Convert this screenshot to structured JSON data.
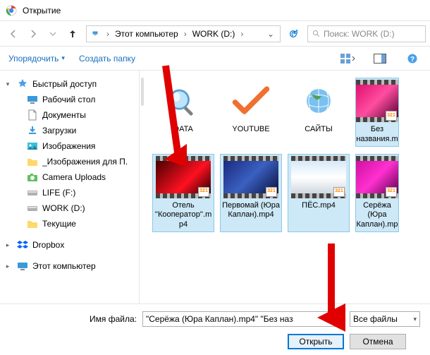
{
  "window": {
    "title": "Открытие"
  },
  "nav": {
    "breadcrumb": [
      "Этот компьютер",
      "WORK (D:)"
    ],
    "search_placeholder": "Поиск: WORK (D:)"
  },
  "toolbar": {
    "organize": "Упорядочить",
    "newfolder": "Создать папку"
  },
  "sidebar": {
    "quick": {
      "header": "Быстрый доступ",
      "items": [
        {
          "key": "desktop",
          "label": "Рабочий стол"
        },
        {
          "key": "documents",
          "label": "Документы"
        },
        {
          "key": "downloads",
          "label": "Загрузки"
        },
        {
          "key": "pictures",
          "label": "Изображения"
        },
        {
          "key": "picfolder",
          "label": "_Изображения для П."
        },
        {
          "key": "camera",
          "label": "Camera Uploads"
        },
        {
          "key": "life",
          "label": "LIFE (F:)"
        },
        {
          "key": "work",
          "label": "WORK (D:)"
        },
        {
          "key": "current",
          "label": "Текущие"
        }
      ]
    },
    "dropbox": "Dropbox",
    "thispc": "Этот компьютер"
  },
  "files": {
    "folders": [
      {
        "key": "data",
        "label": "DATA",
        "icon": "magnifier"
      },
      {
        "key": "youtube",
        "label": "YOUTUBE",
        "icon": "check"
      },
      {
        "key": "sites",
        "label": "САЙТЫ",
        "icon": "globe"
      }
    ],
    "videos": [
      {
        "key": "untitled",
        "label": "Без названия.m",
        "cls": "pink",
        "selected": true,
        "cut": true
      },
      {
        "key": "hotel",
        "label": "Отель ''Кооператор''.mp4",
        "cls": "red",
        "selected": true
      },
      {
        "key": "pervomay",
        "label": "Первомай (Юра Каплан).mp4",
        "cls": "blue",
        "selected": true
      },
      {
        "key": "pes",
        "label": "ПЁС.mp4",
        "cls": "white",
        "selected": true
      },
      {
        "key": "sereja",
        "label": "Серёжа (Юра Каплан).mp",
        "cls": "pink2",
        "selected": true,
        "cut": true
      }
    ]
  },
  "footer": {
    "filename_label": "Имя файла:",
    "filename_value": "\"Серёжа (Юра Каплан).mp4\" \"Без наз",
    "filter_label": "Все файлы",
    "open": "Открыть",
    "cancel": "Отмена"
  }
}
